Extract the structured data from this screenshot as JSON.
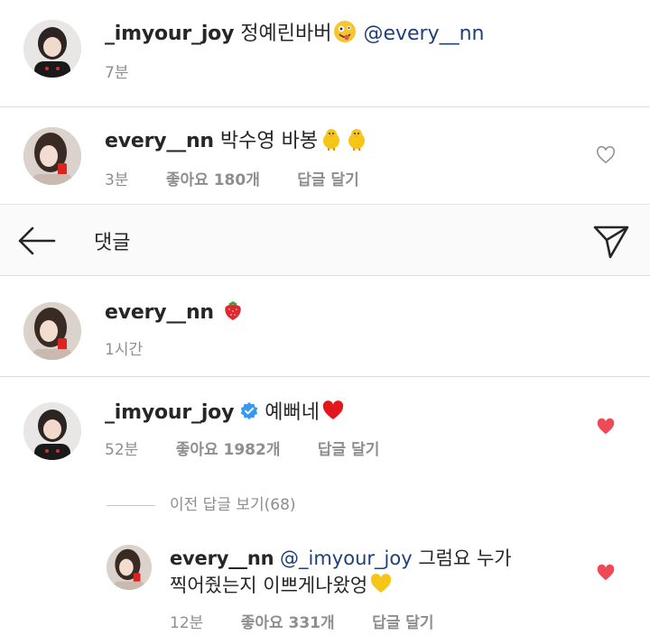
{
  "comments": [
    {
      "username": "_imyour_joy",
      "text": "정예린바버",
      "emoji": "zany-face-emoji",
      "mention": "@every__nn",
      "time": "7분"
    },
    {
      "username": "every__nn",
      "text": "박수영 바봉",
      "emoji": "chick-emoji",
      "time": "3분",
      "likes": "좋아요 180개",
      "reply": "답글 달기",
      "liked": false
    }
  ],
  "header": {
    "title": "댓글",
    "back_icon": "arrow-left-icon",
    "send_icon": "paper-plane-icon"
  },
  "post": {
    "username": "every__nn",
    "emoji": "strawberry-emoji",
    "time": "1시간"
  },
  "thread": {
    "username": "_imyour_joy",
    "verified": true,
    "text": "예뻐네",
    "emoji": "red-heart-emoji",
    "time": "52분",
    "likes": "좋아요 1982개",
    "reply": "답글 달기",
    "liked": true,
    "view_replies": "이전 답글 보기(68)"
  },
  "reply": {
    "username": "every__nn",
    "mention": "@_imyour_joy",
    "text_line1": "그럼요 누가",
    "text_line2": "찍어줬는지 이쁘게나왔엉",
    "emoji": "yellow-heart-emoji",
    "time": "12분",
    "likes": "좋아요 331개",
    "reply": "답글 달기",
    "liked": true
  },
  "colors": {
    "text": "#262626",
    "meta": "#8e8e8e",
    "mention": "#1e3f7a",
    "liked_heart": "#ed4956",
    "verified": "#3897f0"
  }
}
